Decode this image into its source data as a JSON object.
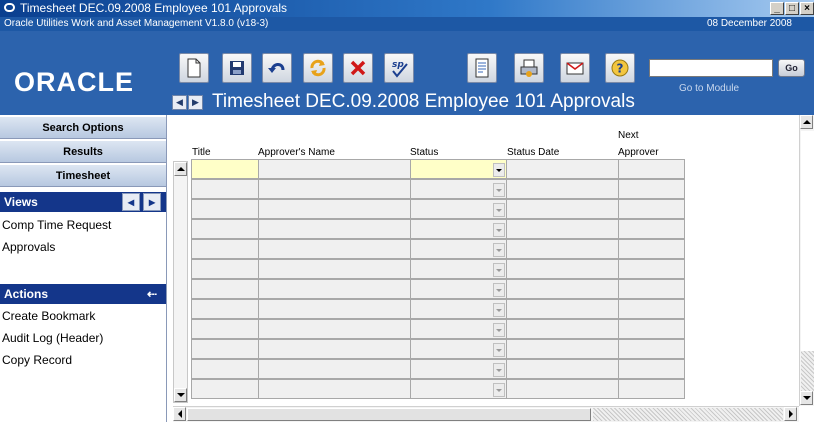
{
  "window": {
    "title": "Timesheet DEC.09.2008 Employee 101 Approvals",
    "app_version": "Oracle Utilities Work and Asset Management V1.8.0 (v18-3)",
    "date": "08 December  2008"
  },
  "brand": {
    "logo": "ORACLE"
  },
  "toolbar": {
    "buttons": [
      "new-icon",
      "save-icon",
      "undo-icon",
      "refresh-icon",
      "delete-icon",
      "spell-check-icon",
      "report-icon",
      "print-icon",
      "mail-icon",
      "help-icon"
    ],
    "go_label": "Go",
    "goto_label": "Go to Module",
    "goto_value": ""
  },
  "page": {
    "title": "Timesheet DEC.09.2008 Employee 101 Approvals"
  },
  "sidebar": {
    "tabs": [
      "Search Options",
      "Results",
      "Timesheet"
    ],
    "views_label": "Views",
    "views": [
      "Comp Time Request",
      "Approvals"
    ],
    "actions_label": "Actions",
    "actions": [
      "Create Bookmark",
      "Audit Log (Header)",
      "Copy Record"
    ]
  },
  "grid": {
    "columns": {
      "title": "Title",
      "approver_name": "Approver's Name",
      "status": "Status",
      "status_date": "Status Date",
      "next_approver_line1": "Next",
      "next_approver_line2": "Approver"
    },
    "row_count": 12
  },
  "colors": {
    "header_blue": "#2c63ad",
    "section_navy": "#14368a",
    "active_cell": "#ffffc8"
  }
}
